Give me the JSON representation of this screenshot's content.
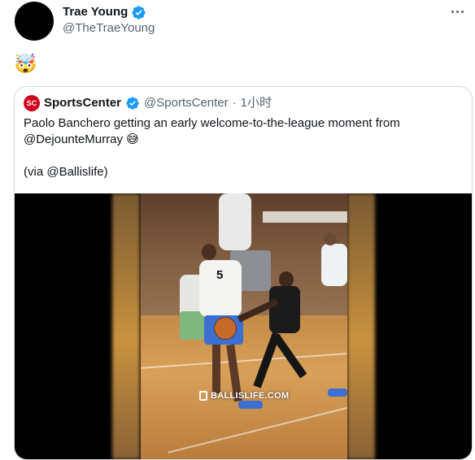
{
  "tweet": {
    "author_name": "Trae Young",
    "author_handle": "@TheTraeYoung",
    "text": "🤯"
  },
  "quoted": {
    "logo_text": "SC",
    "author_name": "SportsCenter",
    "author_handle": "@SportsCenter",
    "separator": "·",
    "time": "1小时",
    "text": "Paolo Banchero getting an early welcome-to-the-league moment from @DejounteMurray 😅\n\n(via @Ballislife)",
    "media": {
      "watermark": "BALLISLIFE.COM",
      "jersey_number": "5"
    }
  },
  "icons": {
    "verified": "verified-badge-icon",
    "more": "more-options-icon"
  },
  "colors": {
    "verified": "#1d9bf0",
    "secondary_text": "#536471",
    "border": "#cfd9de",
    "espn_red": "#d0021b"
  }
}
